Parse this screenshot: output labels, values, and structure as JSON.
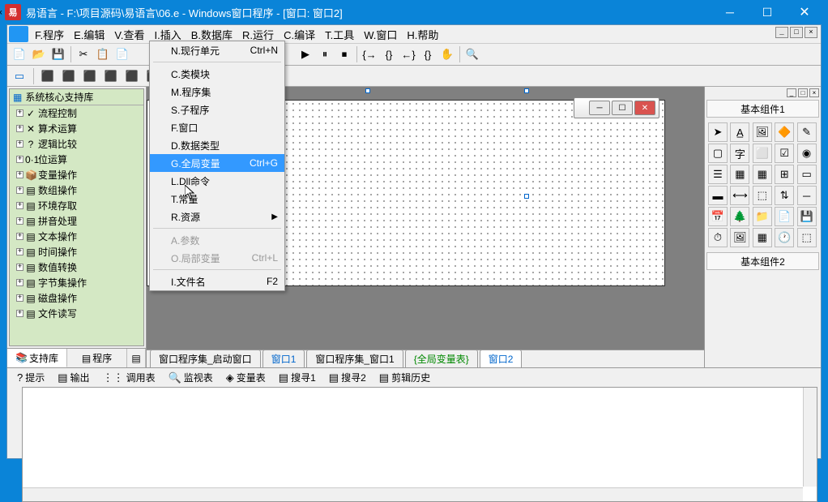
{
  "titlebar": {
    "app_icon_text": "易",
    "title": "易语言 - F:\\项目源码\\易语言\\06.e - Windows窗口程序 - [窗口: 窗口2]"
  },
  "menubar": {
    "items": [
      "F.程序",
      "E.编辑",
      "V.查看",
      "I.插入",
      "B.数据库",
      "R.运行",
      "C.编译",
      "T.工具",
      "W.窗口",
      "H.帮助"
    ]
  },
  "dropdown": {
    "items": [
      {
        "label": "N.现行单元",
        "shortcut": "Ctrl+N"
      },
      {
        "sep": true
      },
      {
        "label": "C.类模块"
      },
      {
        "label": "M.程序集"
      },
      {
        "label": "S.子程序"
      },
      {
        "label": "F.窗口"
      },
      {
        "label": "D.数据类型"
      },
      {
        "label": "G.全局变量",
        "shortcut": "Ctrl+G",
        "highlighted": true
      },
      {
        "label": "L.Dll命令"
      },
      {
        "label": "T.常量"
      },
      {
        "label": "R.资源",
        "submenu": true
      },
      {
        "sep": true
      },
      {
        "label": "A.参数",
        "disabled": true
      },
      {
        "label": "O.局部变量",
        "shortcut": "Ctrl+L",
        "disabled": true
      },
      {
        "sep": true
      },
      {
        "label": "I.文件名",
        "shortcut": "F2"
      }
    ]
  },
  "tree": {
    "header": "系统核心支持库",
    "items": [
      {
        "icon": "✓",
        "label": "流程控制"
      },
      {
        "icon": "✕",
        "label": "算术运算"
      },
      {
        "icon": "?",
        "label": "逻辑比较"
      },
      {
        "icon": "0·1",
        "label": "位运算"
      },
      {
        "icon": "📦",
        "label": "变量操作"
      },
      {
        "icon": "▤",
        "label": "数组操作"
      },
      {
        "icon": "▤",
        "label": "环境存取"
      },
      {
        "icon": "▤",
        "label": "拼音处理"
      },
      {
        "icon": "▤",
        "label": "文本操作"
      },
      {
        "icon": "▤",
        "label": "时间操作"
      },
      {
        "icon": "▤",
        "label": "数值转换"
      },
      {
        "icon": "▤",
        "label": "字节集操作"
      },
      {
        "icon": "▤",
        "label": "磁盘操作"
      },
      {
        "icon": "▤",
        "label": "文件读写"
      }
    ]
  },
  "sidebar_tabs": [
    "支持库",
    "程序"
  ],
  "doc_tabs": [
    {
      "label": "窗口程序集_启动窗口"
    },
    {
      "label": "窗口1",
      "special": true
    },
    {
      "label": "窗口程序集_窗口1"
    },
    {
      "label": "{全局变量表}",
      "special2": true
    },
    {
      "label": "窗口2",
      "special": true,
      "active": true
    }
  ],
  "right_panel": {
    "title1": "基本组件1",
    "title2": "基本组件2"
  },
  "bottom_tabs": [
    {
      "icon": "?",
      "label": "提示"
    },
    {
      "icon": "▤",
      "label": "输出"
    },
    {
      "icon": "⋮⋮",
      "label": "调用表"
    },
    {
      "icon": "🔍",
      "label": "监视表"
    },
    {
      "icon": "◈",
      "label": "变量表"
    },
    {
      "icon": "▤",
      "label": "搜寻1"
    },
    {
      "icon": "▤",
      "label": "搜寻2"
    },
    {
      "icon": "▤",
      "label": "剪辑历史"
    }
  ]
}
